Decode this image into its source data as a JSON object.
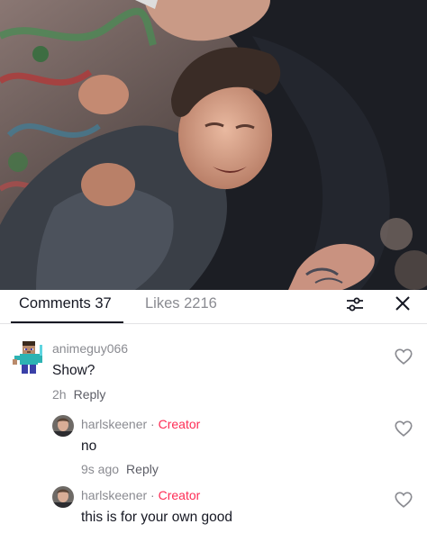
{
  "tabs": {
    "comments_label": "Comments 37",
    "likes_label": "Likes 2216"
  },
  "icons": {
    "filter": "sliders-icon",
    "close": "close-icon",
    "like": "heart-outline-icon"
  },
  "comments": [
    {
      "username": "animeguy066",
      "text": "Show?",
      "time": "2h",
      "reply_label": "Reply",
      "avatar": "minecraft-steve-avatar"
    }
  ],
  "replies": [
    {
      "username": "harlskeener",
      "badge": "Creator",
      "text": "no",
      "time": "9s ago",
      "reply_label": "Reply"
    },
    {
      "username": "harlskeener",
      "badge": "Creator",
      "text": "this is for your own good"
    }
  ],
  "colors": {
    "creator_badge": "#fe2c55",
    "secondary_text": "#8a8b91",
    "primary_text": "#161823"
  }
}
